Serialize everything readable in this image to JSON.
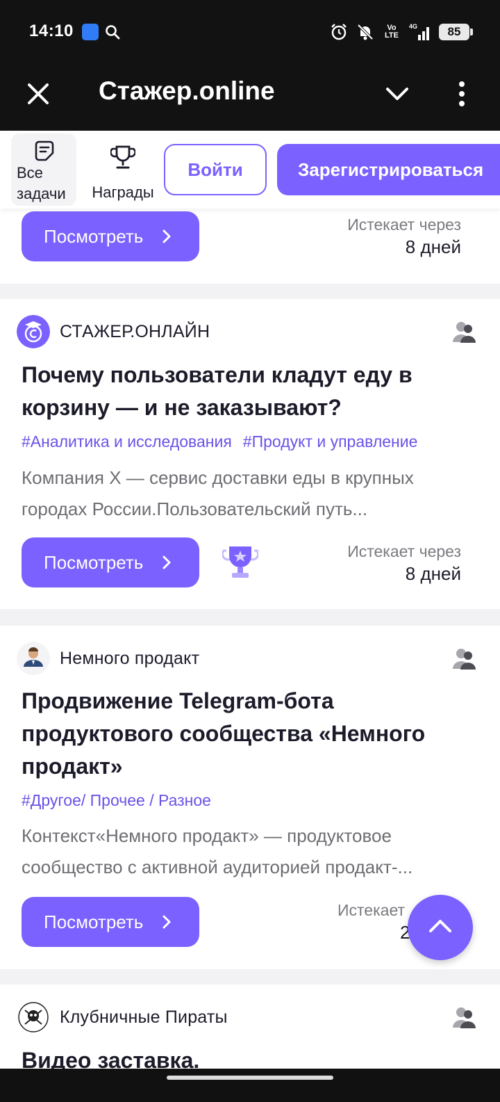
{
  "status_bar": {
    "time": "14:10",
    "volte_label": "Vo LTE",
    "battery": "85"
  },
  "app_bar": {
    "title": "Стажер.online"
  },
  "nav": {
    "all_tasks": "Все задачи",
    "awards": "Награды",
    "login": "Войти",
    "register": "Зарегистрироваться"
  },
  "cards": [
    {
      "view_label": "Посмотреть",
      "expires_label": "Истекает через",
      "expires_value": "8 дней"
    },
    {
      "org": "СТАЖЕР.ОНЛАЙН",
      "title": "Почему пользователи кладут еду в корзину — и не заказывают?",
      "tags": [
        "#Аналитика и исследования",
        "#Продукт и управление"
      ],
      "description": "Компания X — сервис доставки еды в крупных городах России.Пользовательский путь...",
      "view_label": "Посмотреть",
      "expires_label": "Истекает через",
      "expires_value": "8 дней"
    },
    {
      "org": "Немного продакт",
      "title": "Продвижение Telegram-бота продуктового сообщества «Немного продакт»",
      "tags": [
        "#Другое/ Прочее / Разное"
      ],
      "description": "Контекст«Немного продакт» — продуктовое сообщество с активной аудиторией продакт-...",
      "view_label": "Посмотреть",
      "expires_label": "Истекает",
      "expires_value": "2"
    },
    {
      "org": "Клубничные Пираты",
      "title": "Видео заставка."
    }
  ],
  "colors": {
    "accent": "#7b61ff",
    "tag": "#6a52e8",
    "dark_bar": "#121212"
  }
}
